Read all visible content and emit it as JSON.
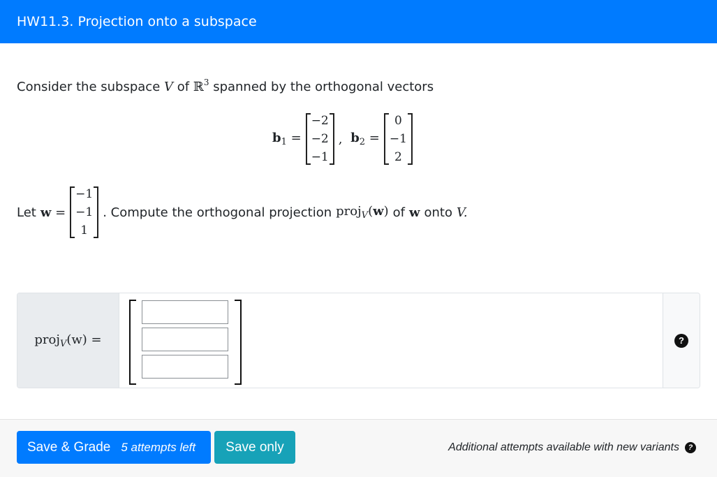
{
  "header": {
    "title": "HW11.3. Projection onto a subspace"
  },
  "question": {
    "intro_prefix": "Consider the subspace",
    "intro_V": "V",
    "intro_of": "of",
    "intro_R": "ℝ",
    "intro_R_exp": "3",
    "intro_suffix": "spanned by the orthogonal vectors",
    "b1_label": "b",
    "b1_sub": "1",
    "b1": [
      "−2",
      "−2",
      "−1"
    ],
    "b2_label": "b",
    "b2_sub": "2",
    "b2": [
      "0",
      "−1",
      "2"
    ],
    "let_prefix": "Let",
    "w_label": "w",
    "w": [
      "−1",
      "−1",
      "1"
    ],
    "compute_text": ". Compute the orthogonal projection",
    "proj_text": "proj",
    "proj_sub": "V",
    "of_text": "of",
    "onto_text": "onto",
    "V_text": "V."
  },
  "answer": {
    "label_proj": "proj",
    "label_sub": "V",
    "label_arg": "(w) =",
    "inputs": [
      "",
      "",
      ""
    ]
  },
  "footer": {
    "grade_label": "Save & Grade",
    "attempts_label": "5 attempts left",
    "save_only_label": "Save only",
    "note": "Additional attempts available with new variants"
  },
  "icons": {
    "help": "question-circle-icon"
  },
  "colors": {
    "primary": "#007bff",
    "info": "#17a2b8",
    "label_bg": "#e9ecef"
  }
}
